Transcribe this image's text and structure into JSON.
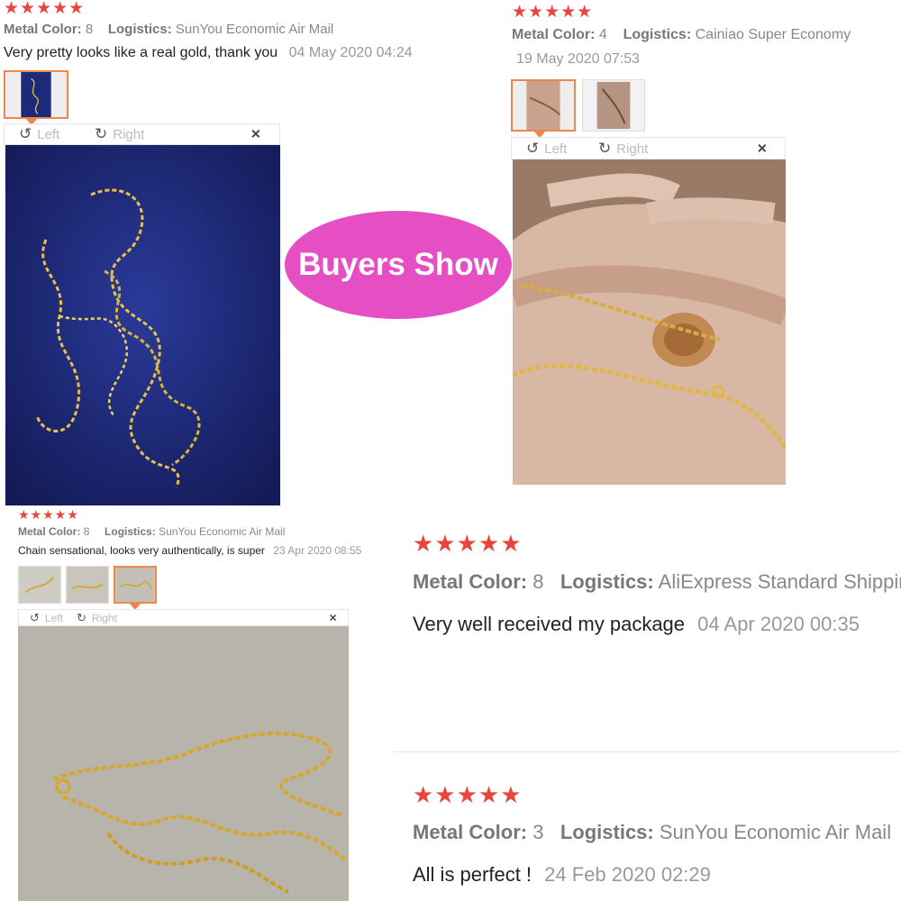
{
  "stars": "★★★★★",
  "toolbar": {
    "left_label": "Left",
    "right_label": "Right",
    "rotate_left_icon": "↺",
    "rotate_right_icon": "↻",
    "close_icon": "✕"
  },
  "banner": {
    "text": "Buyers Show",
    "color": "#e64fc4"
  },
  "reviews": [
    {
      "metal_color_label": "Metal Color:",
      "metal_color_value": "8",
      "logistics_label": "Logistics:",
      "logistics_value": "SunYou Economic Air Mail",
      "comment": "Very pretty looks like a real gold, thank you",
      "date": "04 May 2020 04:24"
    },
    {
      "metal_color_label": "Metal Color:",
      "metal_color_value": "4",
      "logistics_label": "Logistics:",
      "logistics_value": "Cainiao Super Economy",
      "comment": "",
      "date": "19 May 2020 07:53"
    },
    {
      "metal_color_label": "Metal Color:",
      "metal_color_value": "8",
      "logistics_label": "Logistics:",
      "logistics_value": "SunYou Economic Air Mail",
      "comment": "Chain sensational, looks very authentically, is super",
      "date": "23 Apr 2020 08:55"
    },
    {
      "metal_color_label": "Metal Color:",
      "metal_color_value": "8",
      "logistics_label": "Logistics:",
      "logistics_value": "AliExpress Standard Shipping",
      "comment": "Very well received my package",
      "date": "04 Apr 2020 00:35"
    },
    {
      "metal_color_label": "Metal Color:",
      "metal_color_value": "3",
      "logistics_label": "Logistics:",
      "logistics_value": "SunYou Economic Air Mail",
      "comment": "All is perfect !",
      "date": "24 Feb 2020 02:29"
    }
  ],
  "colors": {
    "star": "#e8463c",
    "selected_thumb_border": "#f0874a",
    "photo1_bg": "#1d2a7a",
    "photo2_bg": "#c89a80",
    "photo3_bg": "#b9b6ad"
  }
}
